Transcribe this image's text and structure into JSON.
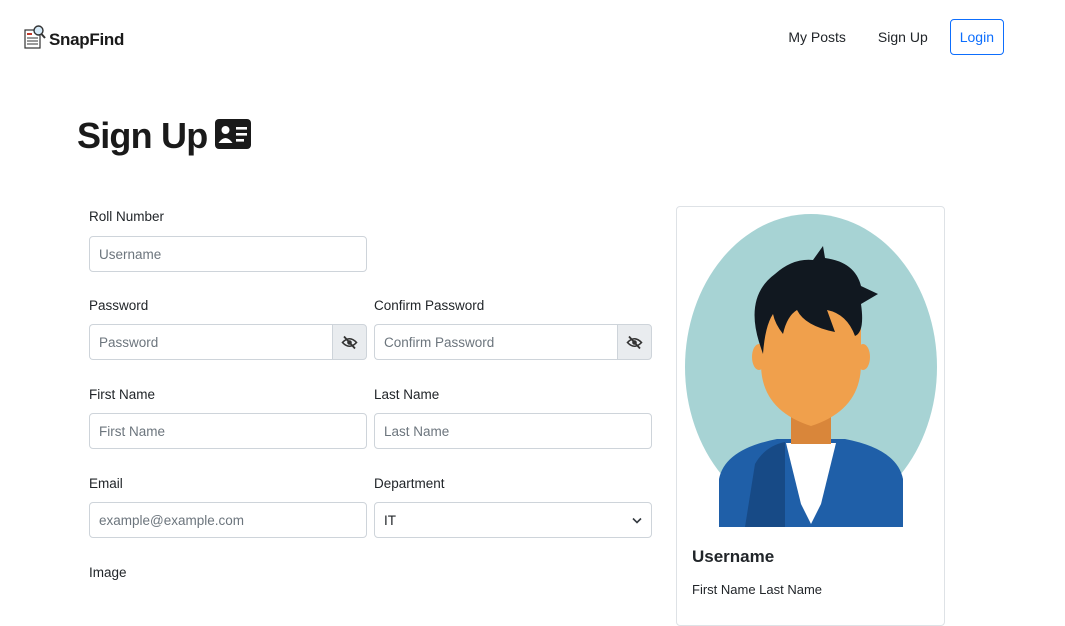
{
  "app": {
    "brand": "SnapFind"
  },
  "nav": {
    "my_posts": "My Posts",
    "sign_up": "Sign Up",
    "login": "Login"
  },
  "page": {
    "title": "Sign Up"
  },
  "form": {
    "roll_number": {
      "label": "Roll Number",
      "placeholder": "Username"
    },
    "password": {
      "label": "Password",
      "placeholder": "Password"
    },
    "confirm_password": {
      "label": "Confirm Password",
      "placeholder": "Confirm Password"
    },
    "first_name": {
      "label": "First Name",
      "placeholder": "First Name"
    },
    "last_name": {
      "label": "Last Name",
      "placeholder": "Last Name"
    },
    "email": {
      "label": "Email",
      "placeholder": "example@example.com"
    },
    "department": {
      "label": "Department",
      "value": "IT"
    },
    "image": {
      "label": "Image"
    }
  },
  "card": {
    "username": "Username",
    "full_name": "First Name Last Name"
  },
  "icons": {
    "brand": "newspaper-search-icon",
    "title": "person-vcard-icon",
    "toggle_password": "eye-slash-icon",
    "select": "chevron-down-icon"
  },
  "colors": {
    "primary": "#0d6efd",
    "avatar_background": "#a7d3d4",
    "hair": "#111820",
    "skin": "#f0a04c",
    "jacket": "#1f5fa8",
    "shirt": "#ffffff"
  }
}
